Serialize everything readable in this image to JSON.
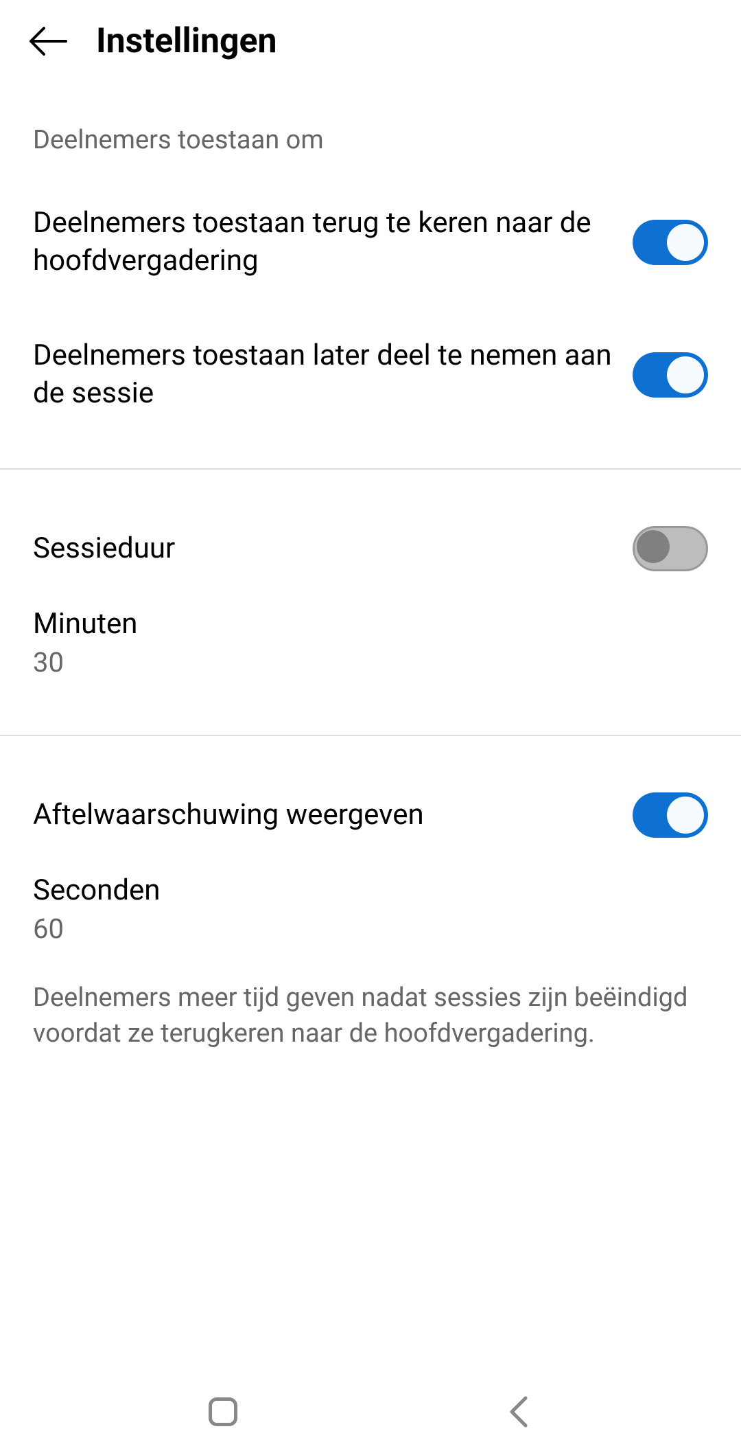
{
  "header": {
    "title": "Instellingen"
  },
  "section1": {
    "label": "Deelnemers toestaan om",
    "items": [
      {
        "label": "Deelnemers toestaan terug te keren naar de hoofdvergadering",
        "on": true
      },
      {
        "label": "Deelnemers toestaan later deel te nemen aan de sessie",
        "on": true
      }
    ]
  },
  "section2": {
    "toggle": {
      "label": "Sessieduur",
      "on": false
    },
    "value": {
      "label": "Minuten",
      "number": "30"
    }
  },
  "section3": {
    "toggle": {
      "label": "Aftelwaarschuwing weergeven",
      "on": true
    },
    "value": {
      "label": "Seconden",
      "number": "60"
    },
    "description": "Deelnemers meer tijd geven nadat sessies zijn beëindigd voordat ze terugkeren naar de hoofdvergadering."
  }
}
